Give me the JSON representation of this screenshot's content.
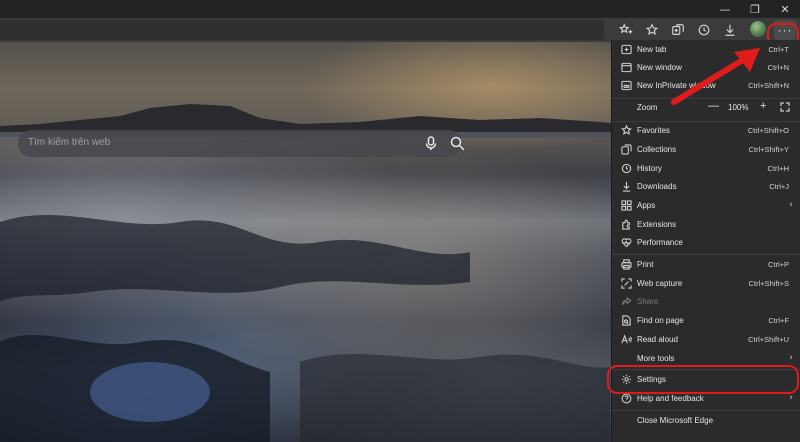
{
  "window": {
    "min": "—",
    "restore": "❐",
    "close": "✕"
  },
  "search": {
    "placeholder": "Tìm kiếm trên web"
  },
  "menu": {
    "new_tab": {
      "label": "New tab",
      "shortcut": "Ctrl+T"
    },
    "new_window": {
      "label": "New window",
      "shortcut": "Ctrl+N"
    },
    "new_inprivate": {
      "label": "New InPrivate window",
      "shortcut": "Ctrl+Shift+N"
    },
    "zoom": {
      "label": "Zoom",
      "minus": "—",
      "value": "100%",
      "plus": "+"
    },
    "favorites": {
      "label": "Favorites",
      "shortcut": "Ctrl+Shift+O"
    },
    "collections": {
      "label": "Collections",
      "shortcut": "Ctrl+Shift+Y"
    },
    "history": {
      "label": "History",
      "shortcut": "Ctrl+H"
    },
    "downloads": {
      "label": "Downloads",
      "shortcut": "Ctrl+J"
    },
    "apps": {
      "label": "Apps",
      "chevron": "›"
    },
    "extensions": {
      "label": "Extensions"
    },
    "performance": {
      "label": "Performance"
    },
    "print": {
      "label": "Print",
      "shortcut": "Ctrl+P"
    },
    "web_capture": {
      "label": "Web capture",
      "shortcut": "Ctrl+Shift+S"
    },
    "share": {
      "label": "Share"
    },
    "find_on_page": {
      "label": "Find on page",
      "shortcut": "Ctrl+F"
    },
    "read_aloud": {
      "label": "Read aloud",
      "shortcut": "Ctrl+Shift+U"
    },
    "more_tools": {
      "label": "More tools",
      "chevron": "›"
    },
    "settings": {
      "label": "Settings"
    },
    "help_feedback": {
      "label": "Help and feedback",
      "chevron": "›"
    },
    "close_edge": {
      "label": "Close Microsoft Edge"
    }
  },
  "colors": {
    "annotation": "#e01b1b",
    "menu_bg": "#2b2b2b"
  }
}
